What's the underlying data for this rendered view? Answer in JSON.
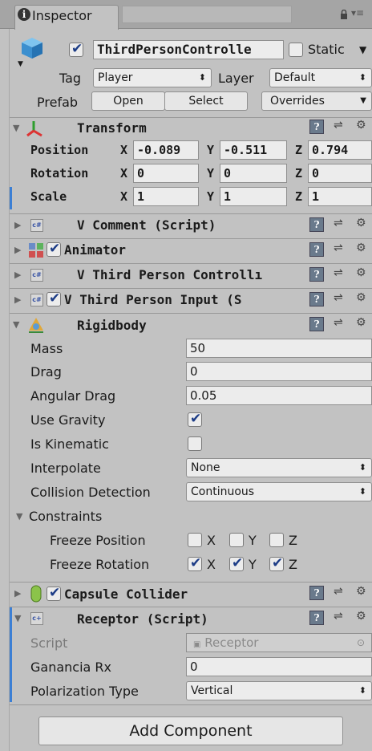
{
  "tab": {
    "label": "Inspector"
  },
  "header": {
    "object_name": "ThirdPersonControlle",
    "static_label": "Static",
    "tag_label": "Tag",
    "tag_value": "Player",
    "layer_label": "Layer",
    "layer_value": "Default",
    "prefab_label": "Prefab",
    "open_label": "Open",
    "select_label": "Select",
    "overrides_label": "Overrides"
  },
  "transform": {
    "title": "Transform",
    "position_label": "Position",
    "rotation_label": "Rotation",
    "scale_label": "Scale",
    "x": "X",
    "y": "Y",
    "z": "Z",
    "position": [
      "-0.089",
      "-0.511",
      "0.794"
    ],
    "rotation": [
      "0",
      "0",
      "0"
    ],
    "scale": [
      "1",
      "1",
      "1"
    ]
  },
  "components": {
    "v_comment": "V Comment (Script)",
    "animator": "Animator",
    "v_controller": "V Third Person Controllı",
    "v_input": "V Third Person Input (S"
  },
  "rigidbody": {
    "title": "Rigidbody",
    "mass_label": "Mass",
    "mass": "50",
    "drag_label": "Drag",
    "drag": "0",
    "angular_drag_label": "Angular Drag",
    "angular_drag": "0.05",
    "use_gravity_label": "Use Gravity",
    "is_kinematic_label": "Is Kinematic",
    "interpolate_label": "Interpolate",
    "interpolate": "None",
    "collision_label": "Collision Detection",
    "collision": "Continuous",
    "constraints_label": "Constraints",
    "freeze_position_label": "Freeze Position",
    "freeze_rotation_label": "Freeze Rotation",
    "x": "X",
    "y": "Y",
    "z": "Z"
  },
  "capsule": {
    "title": "Capsule Collider"
  },
  "receptor": {
    "title": "Receptor (Script)",
    "script_label": "Script",
    "script_value": "Receptor",
    "ganancia_label": "Ganancia Rx",
    "ganancia": "0",
    "polarization_label": "Polarization Type",
    "polarization": "Vertical"
  },
  "add_component_label": "Add Component"
}
